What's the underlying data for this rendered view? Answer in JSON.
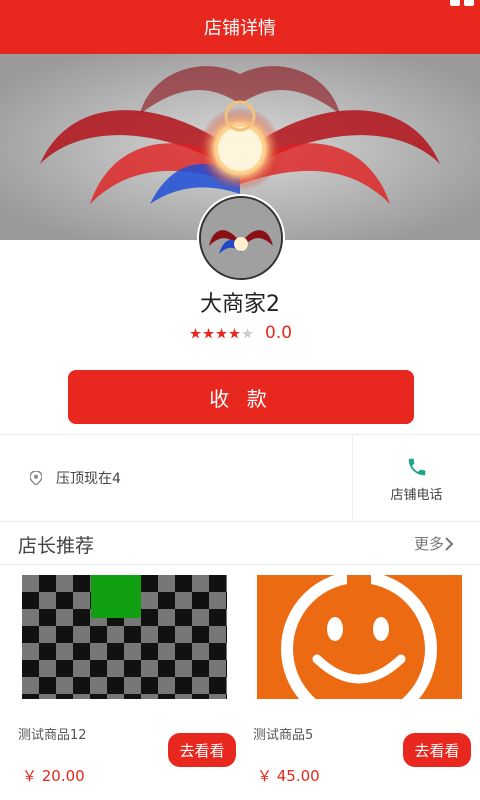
{
  "header": {
    "title": "店铺详情"
  },
  "shop": {
    "name": "大商家2",
    "rating_value": "0.0",
    "stars_filled": 4,
    "stars_total": 5,
    "pay_button": "收 款"
  },
  "info": {
    "address": "压顶现在4",
    "phone_label": "店铺电话"
  },
  "recommend": {
    "title": "店长推荐",
    "more_label": "更多"
  },
  "products": [
    {
      "name": "测试商品12",
      "price": "￥ 20.00",
      "button": "去看看"
    },
    {
      "name": "测试商品5",
      "price": "￥ 45.00",
      "button": "去看看"
    }
  ],
  "colors": {
    "accent": "#e8271e",
    "phone_icon": "#1aa58c"
  },
  "icons": [
    "location-pin-icon",
    "phone-icon",
    "chevron-right-icon",
    "star-icon"
  ]
}
